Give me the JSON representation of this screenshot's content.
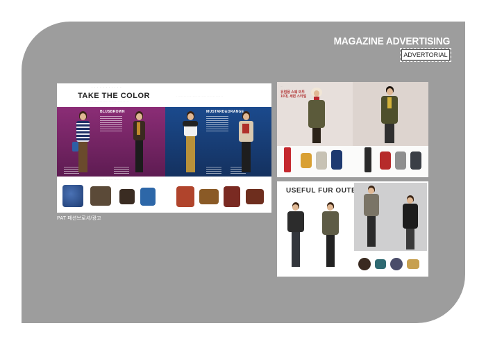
{
  "header": {
    "title": "MAGAZINE ADVERTISING",
    "badge": "ADVERTORIAL"
  },
  "spread_main": {
    "headline": "TAKE THE COLOR",
    "left_panel_label": "BLUSBROWN",
    "right_panel_label": "MUSTARD&ORANGE"
  },
  "spread_top_right": {
    "korean_title": "유럽풍 스웨 외투 10대, 세련 스타일"
  },
  "spread_bottom_right": {
    "headline": "USEFUL FUR OUTERS"
  },
  "caption": "PAT 패션브로셔/광고",
  "colors": {
    "panel": "#9d9d9d",
    "purple_page": "#8b2d76",
    "blue_page": "#1b4a8d"
  }
}
